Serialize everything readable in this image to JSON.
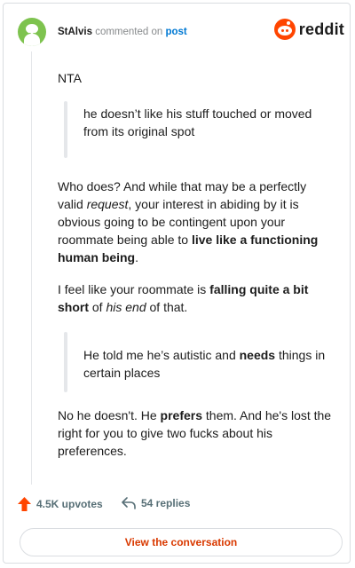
{
  "comment": {
    "username": "StAlvis",
    "action": "commented on",
    "target": "post"
  },
  "brand": {
    "name": "reddit"
  },
  "body": {
    "line1": "NTA",
    "quote1": "he doesn’t like his stuff touched or moved from its original spot",
    "p1": {
      "a": "Who does? And while that may be a perfectly valid ",
      "b": "request",
      "c": ", your interest in abiding by it is obvious going to be contingent upon your roommate being able to ",
      "d": "live like a functioning human being",
      "e": "."
    },
    "p2": {
      "a": "I feel like your roommate is ",
      "b": "falling quite a bit short",
      "c": " of ",
      "d": "his end",
      "e": " of that."
    },
    "quote2": {
      "a": "He told me he’s autistic and ",
      "b": "needs",
      "c": " things in certain places"
    },
    "p3": {
      "a": "No he doesn't. He ",
      "b": "prefers",
      "c": " them. And he's lost the right for you to give two fucks about his preferences."
    }
  },
  "stats": {
    "upvotes": "4.5K upvotes",
    "replies": "54 replies"
  },
  "cta": {
    "label": "View the conversation"
  },
  "colors": {
    "accent": "#ff4500",
    "link": "#0079d3",
    "cta_text": "#d93900",
    "avatar": "#7ec34f"
  },
  "icons": [
    "avatar-snoo-icon",
    "reddit-logo-icon",
    "upvote-arrow-icon",
    "reply-arrow-icon"
  ]
}
